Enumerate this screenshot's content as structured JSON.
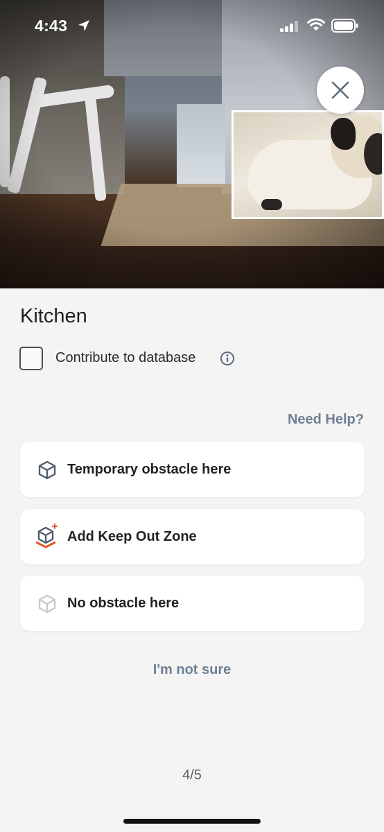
{
  "status": {
    "time": "4:43",
    "icons": [
      "location-arrow-icon",
      "cellular-signal-icon",
      "wifi-icon",
      "battery-icon"
    ]
  },
  "camera": {
    "close_icon": "close-icon"
  },
  "panel": {
    "title": "Kitchen",
    "contribute_label": "Contribute to database",
    "contribute_checked": false,
    "help_link": "Need Help?",
    "options": [
      {
        "label": "Temporary obstacle here",
        "icon": "cube-icon"
      },
      {
        "label": "Add Keep Out Zone",
        "icon": "cube-keep-out-icon"
      },
      {
        "label": "No obstacle here",
        "icon": "cube-faded-icon"
      }
    ],
    "not_sure": "I'm not sure",
    "pager": "4/5"
  },
  "colors": {
    "accent_link": "#6e8192",
    "keep_out_orange": "#e4572e",
    "cube_stroke": "#4f5c6b",
    "cube_faded": "#c5cad1"
  }
}
